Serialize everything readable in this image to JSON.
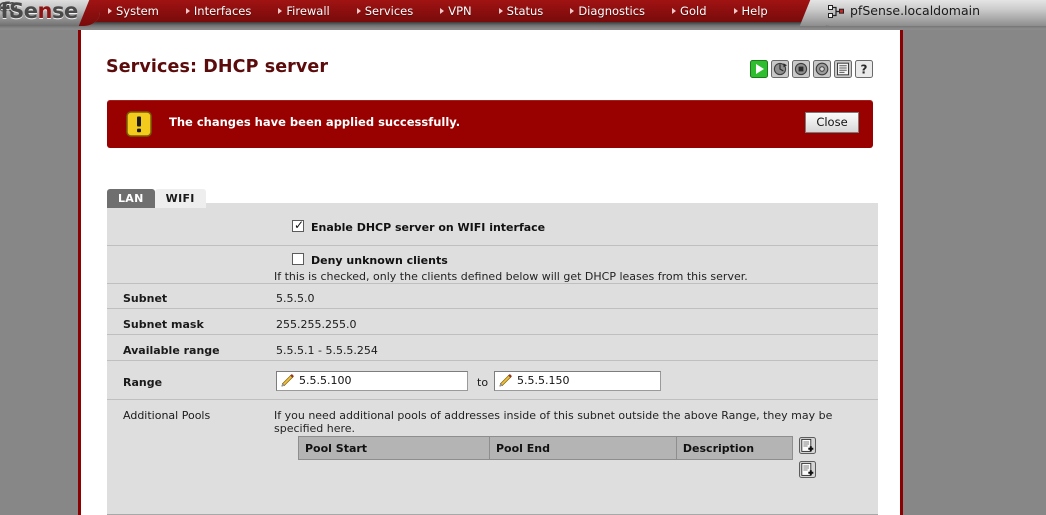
{
  "brand": {
    "logo_text_pf": "pf",
    "logo_text_sense": "Sense",
    "hostname": "pfSense.localdomain",
    "host_icon": "firewall-icon",
    "accent_red": "#8e0f0f",
    "alert_red": "#990000",
    "panel_gray": "#dedede"
  },
  "nav": {
    "items": [
      {
        "label": "System",
        "icon": "chevron-right-icon"
      },
      {
        "label": "Interfaces",
        "icon": "chevron-right-icon"
      },
      {
        "label": "Firewall",
        "icon": "chevron-right-icon"
      },
      {
        "label": "Services",
        "icon": "chevron-right-icon"
      },
      {
        "label": "VPN",
        "icon": "chevron-right-icon"
      },
      {
        "label": "Status",
        "icon": "chevron-right-icon"
      },
      {
        "label": "Diagnostics",
        "icon": "chevron-right-icon"
      },
      {
        "label": "Gold",
        "icon": "chevron-right-icon"
      },
      {
        "label": "Help",
        "icon": "chevron-right-icon"
      }
    ]
  },
  "header": {
    "title": "Services: DHCP server",
    "status_icons": [
      {
        "name": "start-service-icon",
        "title": "start service"
      },
      {
        "name": "restart-dhcp-icon",
        "title": "restart"
      },
      {
        "name": "stop-service-icon",
        "title": "stop"
      },
      {
        "name": "restart-service-icon",
        "title": "restart service"
      },
      {
        "name": "view-log-icon",
        "title": "log"
      },
      {
        "name": "help-icon",
        "title": "help"
      }
    ]
  },
  "alert": {
    "icon": "warning-icon",
    "message": "The changes have been applied successfully.",
    "close_label": "Close"
  },
  "tabs": [
    {
      "label": "LAN",
      "active": false
    },
    {
      "label": "WIFI",
      "active": true
    }
  ],
  "form": {
    "enable_dhcp": {
      "label": "Enable DHCP server on WIFI interface",
      "checked": true
    },
    "deny_unknown": {
      "label": "Deny unknown clients",
      "checked": false,
      "description": "If this is checked, only the clients defined below will get DHCP leases from this server."
    },
    "subnet": {
      "label": "Subnet",
      "value": "5.5.5.0"
    },
    "subnet_mask": {
      "label": "Subnet mask",
      "value": "255.255.255.0"
    },
    "available_range": {
      "label": "Available range",
      "value": "5.5.5.1 - 5.5.5.254"
    },
    "range": {
      "label": "Range",
      "from_value": "5.5.5.100",
      "to_value": "5.5.5.150",
      "separator": "to"
    },
    "additional_pools": {
      "label": "Additional Pools",
      "description": "If you need additional pools of addresses inside of this subnet outside the above Range, they may be specified here.",
      "columns": [
        "Pool Start",
        "Pool End",
        "Description"
      ],
      "rows": [],
      "add_icons": [
        {
          "name": "add-pool-icon-top"
        },
        {
          "name": "add-pool-icon-bottom"
        }
      ]
    }
  }
}
